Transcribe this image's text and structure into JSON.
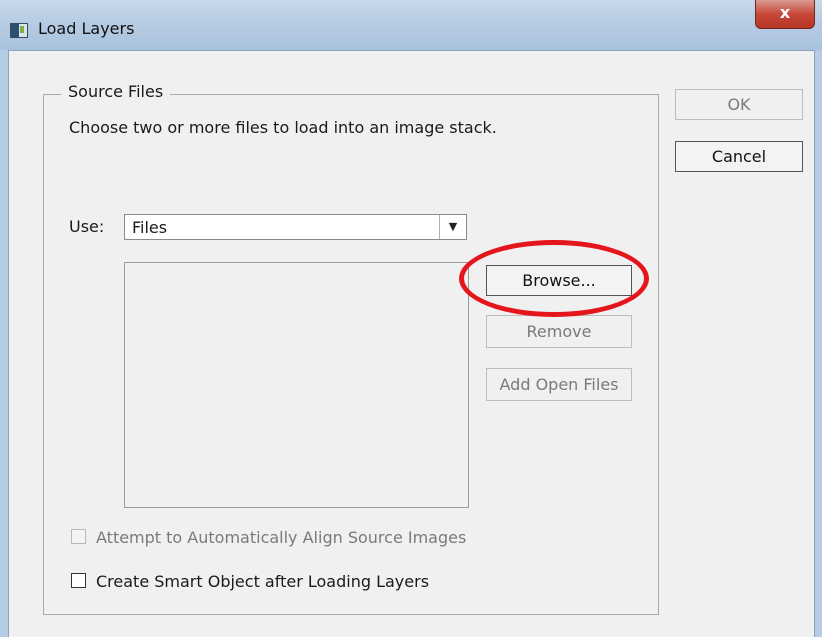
{
  "window": {
    "title": "Load Layers",
    "close_label": "x"
  },
  "source_files": {
    "legend": "Source Files",
    "instructions": "Choose two or more files to load into an image stack.",
    "use_label": "Use:",
    "use_value": "Files",
    "use_arrow": "▼"
  },
  "buttons": {
    "ok": "OK",
    "cancel": "Cancel",
    "browse": "Browse...",
    "remove": "Remove",
    "add_open_files": "Add Open Files"
  },
  "checkboxes": {
    "align_label": "Attempt to Automatically Align Source Images",
    "align_checked": false,
    "align_enabled": false,
    "smart_label": "Create Smart Object after Loading Layers",
    "smart_checked": false
  },
  "colors": {
    "highlight": "#e4161c",
    "close_button": "#c7493a"
  }
}
